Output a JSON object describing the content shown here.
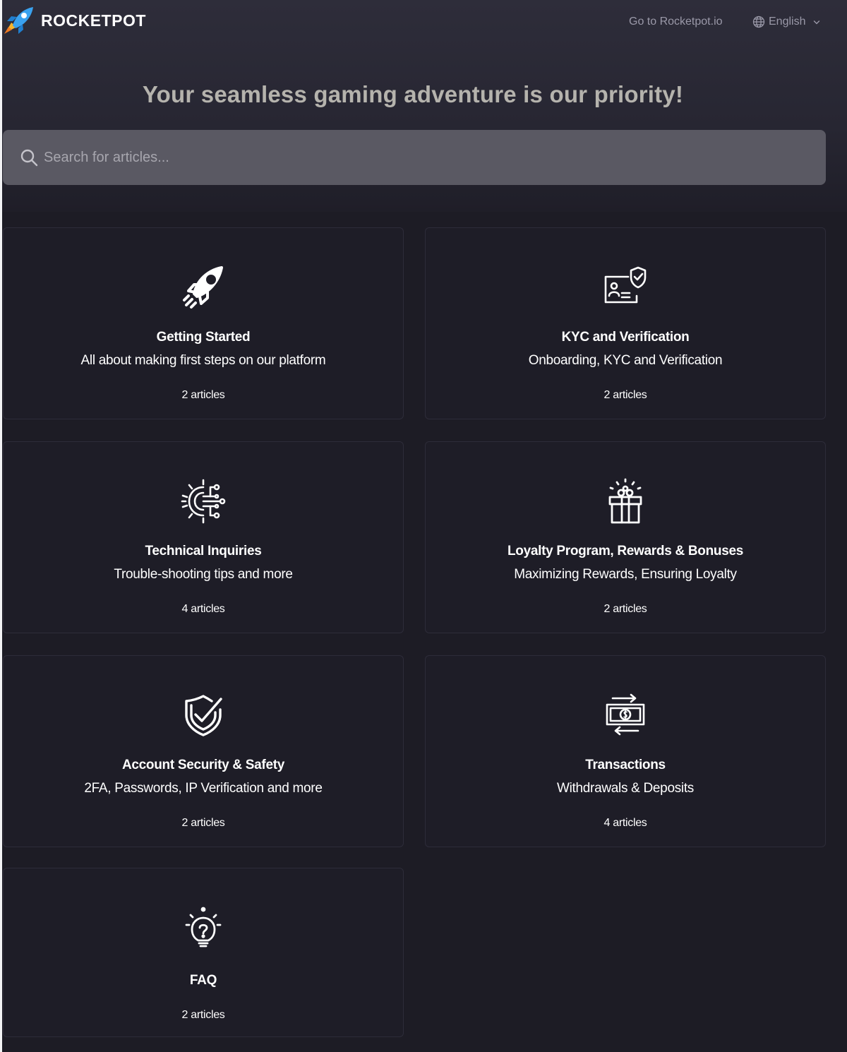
{
  "header": {
    "logo_text": "ROCKETPOT",
    "goto_link": "Go to Rocketpot.io",
    "language": "English"
  },
  "hero": {
    "headline": "Your seamless gaming adventure is our priority!"
  },
  "search": {
    "placeholder": "Search for articles..."
  },
  "categories": [
    {
      "title": "Getting Started",
      "description": "All about making first steps on our platform",
      "count": "2 articles",
      "icon": "rocket-icon"
    },
    {
      "title": "KYC and Verification",
      "description": "Onboarding, KYC and Verification",
      "count": "2 articles",
      "icon": "id-card-shield-icon"
    },
    {
      "title": "Technical Inquiries",
      "description": "Trouble-shooting tips and more",
      "count": "4 articles",
      "icon": "gear-circuit-icon"
    },
    {
      "title": "Loyalty Program, Rewards & Bonuses",
      "description": "Maximizing Rewards, Ensuring Loyalty",
      "count": "2 articles",
      "icon": "gift-icon"
    },
    {
      "title": "Account Security & Safety",
      "description": "2FA, Passwords, IP Verification and more",
      "count": "2 articles",
      "icon": "shield-check-icon"
    },
    {
      "title": "Transactions",
      "description": "Withdrawals & Deposits",
      "count": "4 articles",
      "icon": "money-transfer-icon"
    },
    {
      "title": "FAQ",
      "count": "2 articles",
      "icon": "question-bulb-icon"
    }
  ],
  "colors": {
    "background": "#1d1c25",
    "card_background": "#1e1d27",
    "search_background": "#5a5963",
    "headline": "#b5b3ad",
    "muted_text": "#9a99a8",
    "brand_blue": "#3aa2ef"
  }
}
